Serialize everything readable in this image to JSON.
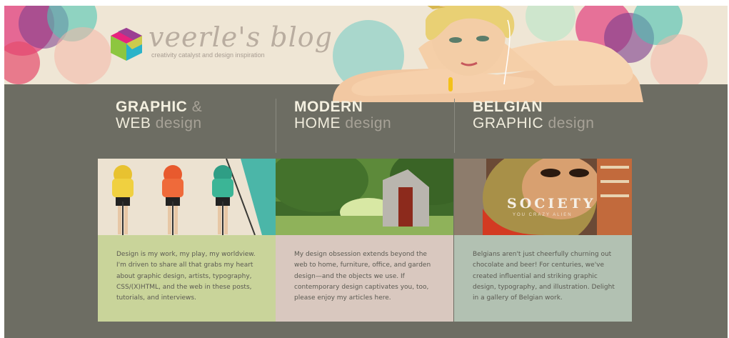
{
  "header": {
    "site_title": "veerle's blog",
    "tagline": "creativity catalyst and design inspiration",
    "brand_color": "#6d6d63",
    "banner_color": "#efe6d5"
  },
  "columns": [
    {
      "title_bold": "GRAPHIC",
      "title_amp": "&",
      "title_light": "WEB",
      "title_muted": "design",
      "box_color": "#c9d49a",
      "description": "Design is my work, my play, my worldview. I'm driven to share all that grabs my heart about graphic design, artists, typography, CSS/(X)HTML, and the web in these posts, tutorials, and interviews."
    },
    {
      "title_bold": "MODERN",
      "title_light": "HOME",
      "title_muted": "design",
      "box_color": "#d9c8bf",
      "description": "My design obsession extends beyond the web to home, furniture, office, and garden design—and the objects we use. If contemporary design captivates you, too, please enjoy my articles here."
    },
    {
      "title_bold": "BELGIAN",
      "title_light": "GRAPHIC",
      "title_muted": "design",
      "box_color": "#b2c1b2",
      "image_text": "SOCIETY",
      "image_subtext": "YOU CRAZY ALIEN",
      "description": "Belgians aren't just cheerfully churning out chocolate and beer! For centuries, we've created influential and striking graphic design, typography, and illustration. Delight in a gallery of Belgian work."
    }
  ]
}
